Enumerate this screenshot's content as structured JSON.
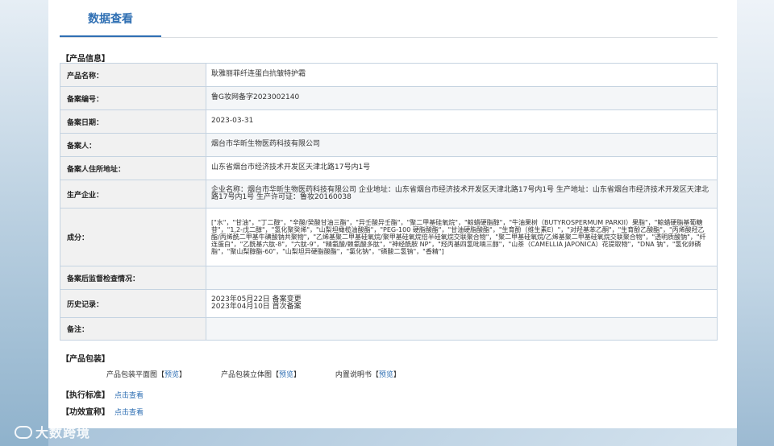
{
  "header": {
    "tab_label": "数据查看"
  },
  "product_info": {
    "section_title": "【产品信息】",
    "rows": [
      {
        "label": "产品名称：",
        "value": "耿雅丽菲纤连蛋白抗皱特护霜"
      },
      {
        "label": "备案编号：",
        "value": "鲁G妆网备字2023002140"
      },
      {
        "label": "备案日期：",
        "value": "2023-03-31"
      },
      {
        "label": "备案人：",
        "value": "烟台市华昕生物医药科技有限公司"
      },
      {
        "label": "备案人住所地址：",
        "value": "山东省烟台市经济技术开发区天津北路17号内1号"
      },
      {
        "label": "生产企业：",
        "value": "企业名称：烟台市华昕生物医药科技有限公司 企业地址：山东省烟台市经济技术开发区天津北路17号内1号 生产地址：山东省烟台市经济技术开发区天津北路17号内1号 生产许可证：鲁妆20160038"
      },
      {
        "label": "成分：",
        "value": "[\"水\"，\"甘油\"，\"丁二醇\"，\"辛酸/癸酸甘油三酯\"，\"异壬酸异壬酯\"，\"聚二甲基硅氧烷\"，\"鲸蜡硬脂醇\"，\"牛油果树（BUTYROSPERMUM PARKII）果脂\"，\"鲸蜡硬脂基葡糖苷\"，\"1,2-戊二醇\"，\"氢化聚癸烯\"，\"山梨坦橄榄油酸酯\"，\"PEG-100 硬脂酸酯\"，\"甘油硬脂酸酯\"，\"生育酚（维生素E）\"，\"对羟基苯乙酮\"，\"生育酚乙酸酯\"，\"丙烯酸羟乙酯/丙烯酰二甲基牛磺酸钠共聚物\"，\"乙烯基聚二甲基硅氧烷/聚甲基硅氧烷倍半硅氧烷交联聚合物\"，\"聚二甲基硅氧烷/乙烯基聚二甲基硅氧烷交联聚合物\"，\"透明质酸钠\"，\"纤连蛋白\"，\"乙酰基六肽-8\"，\"六肽-9\"，\"精氨酸/赖氨酸多肽\"，\"神经酰胺 NP\"，\"羟丙基四氢吡喃三醇\"，\"山茶（CAMELLIA JAPONICA）花提取物\"，\"DNA 钠\"，\"氢化卵磷脂\"，\"聚山梨醇酯-60\"，\"山梨坦异硬脂酸酯\"，\"氯化钠\"，\"磷酸二氢钠\"，\"香精\"]"
      },
      {
        "label": "备案后监督检查情况：",
        "value": ""
      },
      {
        "label": "历史记录：",
        "value": "2023年05月22日 备案变更\n2023年04月10日 首次备案"
      },
      {
        "label": "备注：",
        "value": ""
      }
    ]
  },
  "packaging": {
    "section_title": "【产品包装】",
    "items": [
      {
        "name": "产品包装平面图",
        "link": "预览"
      },
      {
        "name": "产品包装立体图",
        "link": "预览"
      },
      {
        "name": "内置说明书",
        "link": "预览"
      }
    ]
  },
  "standard": {
    "title": "【执行标准】",
    "link": "点击查看"
  },
  "efficacy": {
    "title": "【功效宣称】",
    "link": "点击查看"
  },
  "watermark": "大数跨境"
}
